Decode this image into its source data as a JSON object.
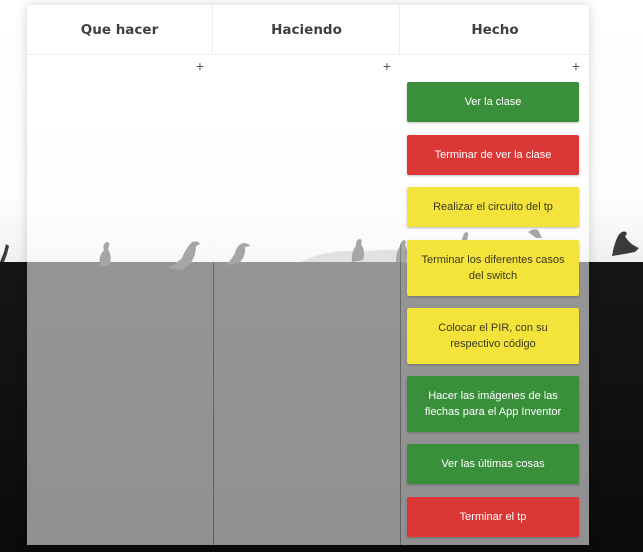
{
  "colors": {
    "green": "#3a8f3b",
    "red": "#dc3737",
    "yellow": "#f4e33a",
    "header_bg": "#ffffff"
  },
  "columns": [
    {
      "title": "Que hacer",
      "add_icon": "+",
      "cards": []
    },
    {
      "title": "Haciendo",
      "add_icon": "+",
      "cards": []
    },
    {
      "title": "Hecho",
      "add_icon": "+",
      "cards": [
        {
          "text": "Ver la clase",
          "color": "green"
        },
        {
          "text": "Terminar de ver la clase",
          "color": "red"
        },
        {
          "text": "Realizar el circuito del tp",
          "color": "yellow"
        },
        {
          "text": "Terminar los diferentes casos del switch",
          "color": "yellow"
        },
        {
          "text": "Colocar el PIR, con su respectivo código",
          "color": "yellow"
        },
        {
          "text": "Hacer las imágenes de las flechas para el App Inventor",
          "color": "green"
        },
        {
          "text": "Ver las últimas cosas",
          "color": "green"
        },
        {
          "text": "Terminar el tp",
          "color": "red"
        }
      ]
    }
  ]
}
